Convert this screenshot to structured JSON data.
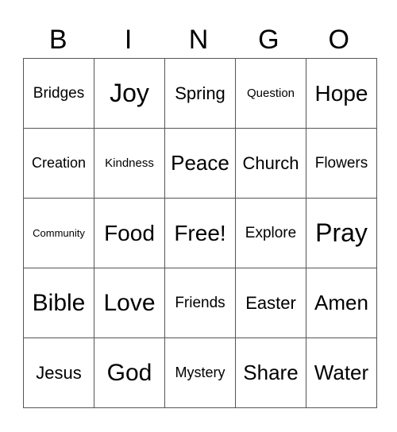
{
  "header": [
    "B",
    "I",
    "N",
    "G",
    "O"
  ],
  "rows": [
    [
      "Bridges",
      "Joy",
      "Spring",
      "Question",
      "Hope"
    ],
    [
      "Creation",
      "Kindness",
      "Peace",
      "Church",
      "Flowers"
    ],
    [
      "Community",
      "Food",
      "Free!",
      "Explore",
      "Pray"
    ],
    [
      "Bible",
      "Love",
      "Friends",
      "Easter",
      "Amen"
    ],
    [
      "Jesus",
      "God",
      "Mystery",
      "Share",
      "Water"
    ]
  ]
}
